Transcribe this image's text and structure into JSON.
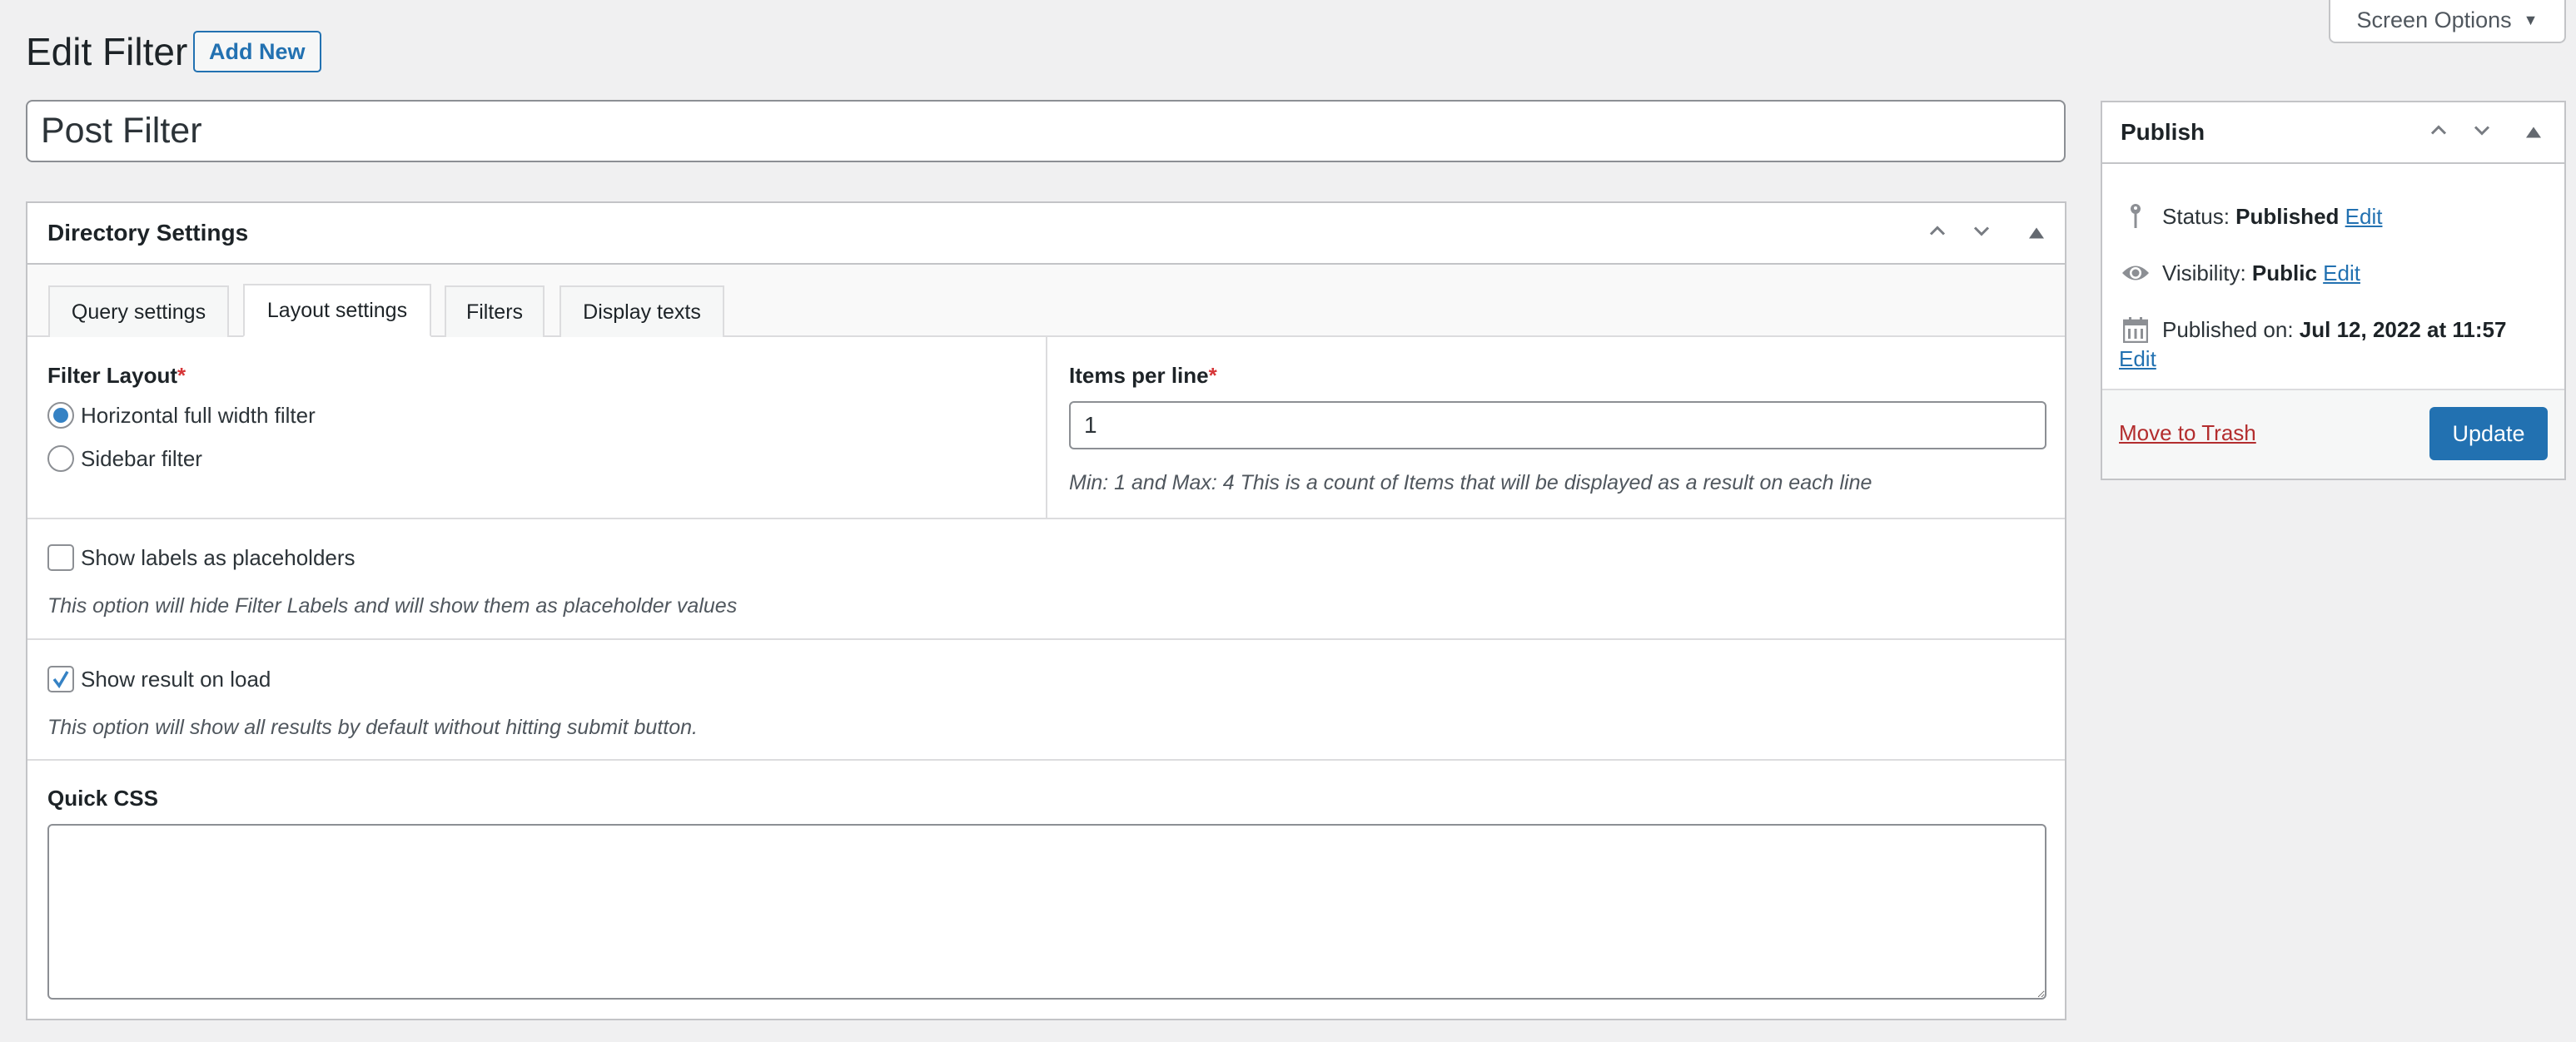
{
  "screen_options": {
    "label": "Screen Options"
  },
  "header": {
    "title": "Edit Filter",
    "add_new_label": "Add New"
  },
  "post_title": {
    "value": "Post Filter"
  },
  "directory_settings": {
    "title": "Directory Settings",
    "tabs": [
      {
        "label": "Query settings",
        "active": false
      },
      {
        "label": "Layout settings",
        "active": true
      },
      {
        "label": "Filters",
        "active": false
      },
      {
        "label": "Display texts",
        "active": false
      }
    ],
    "filter_layout": {
      "label": "Filter Layout",
      "required_mark": "*",
      "options": [
        {
          "label": "Horizontal full width filter",
          "selected": true
        },
        {
          "label": "Sidebar filter",
          "selected": false
        }
      ]
    },
    "items_per_line": {
      "label": "Items per line",
      "required_mark": "*",
      "value": "1",
      "hint": "Min: 1 and Max: 4 This is a count of Items that will be displayed as a result on each line"
    },
    "show_labels_as_placeholders": {
      "label": "Show labels as placeholders",
      "checked": false,
      "hint": "This option will hide Filter Labels and will show them as placeholder values"
    },
    "show_result_on_load": {
      "label": "Show result on load",
      "checked": true,
      "hint": "This option will show all results by default without hitting submit button."
    },
    "quick_css": {
      "label": "Quick CSS",
      "value": ""
    }
  },
  "publish": {
    "title": "Publish",
    "status_label": "Status:",
    "status_value": "Published",
    "visibility_label": "Visibility:",
    "visibility_value": "Public",
    "published_on_label": "Published on:",
    "published_on_value": "Jul 12, 2022 at 11:57",
    "edit_label": "Edit",
    "trash_label": "Move to Trash",
    "update_label": "Update"
  },
  "colors": {
    "accent": "#2271b1",
    "danger": "#b32d2e",
    "required": "#d63638",
    "background": "#f0f0f1"
  }
}
